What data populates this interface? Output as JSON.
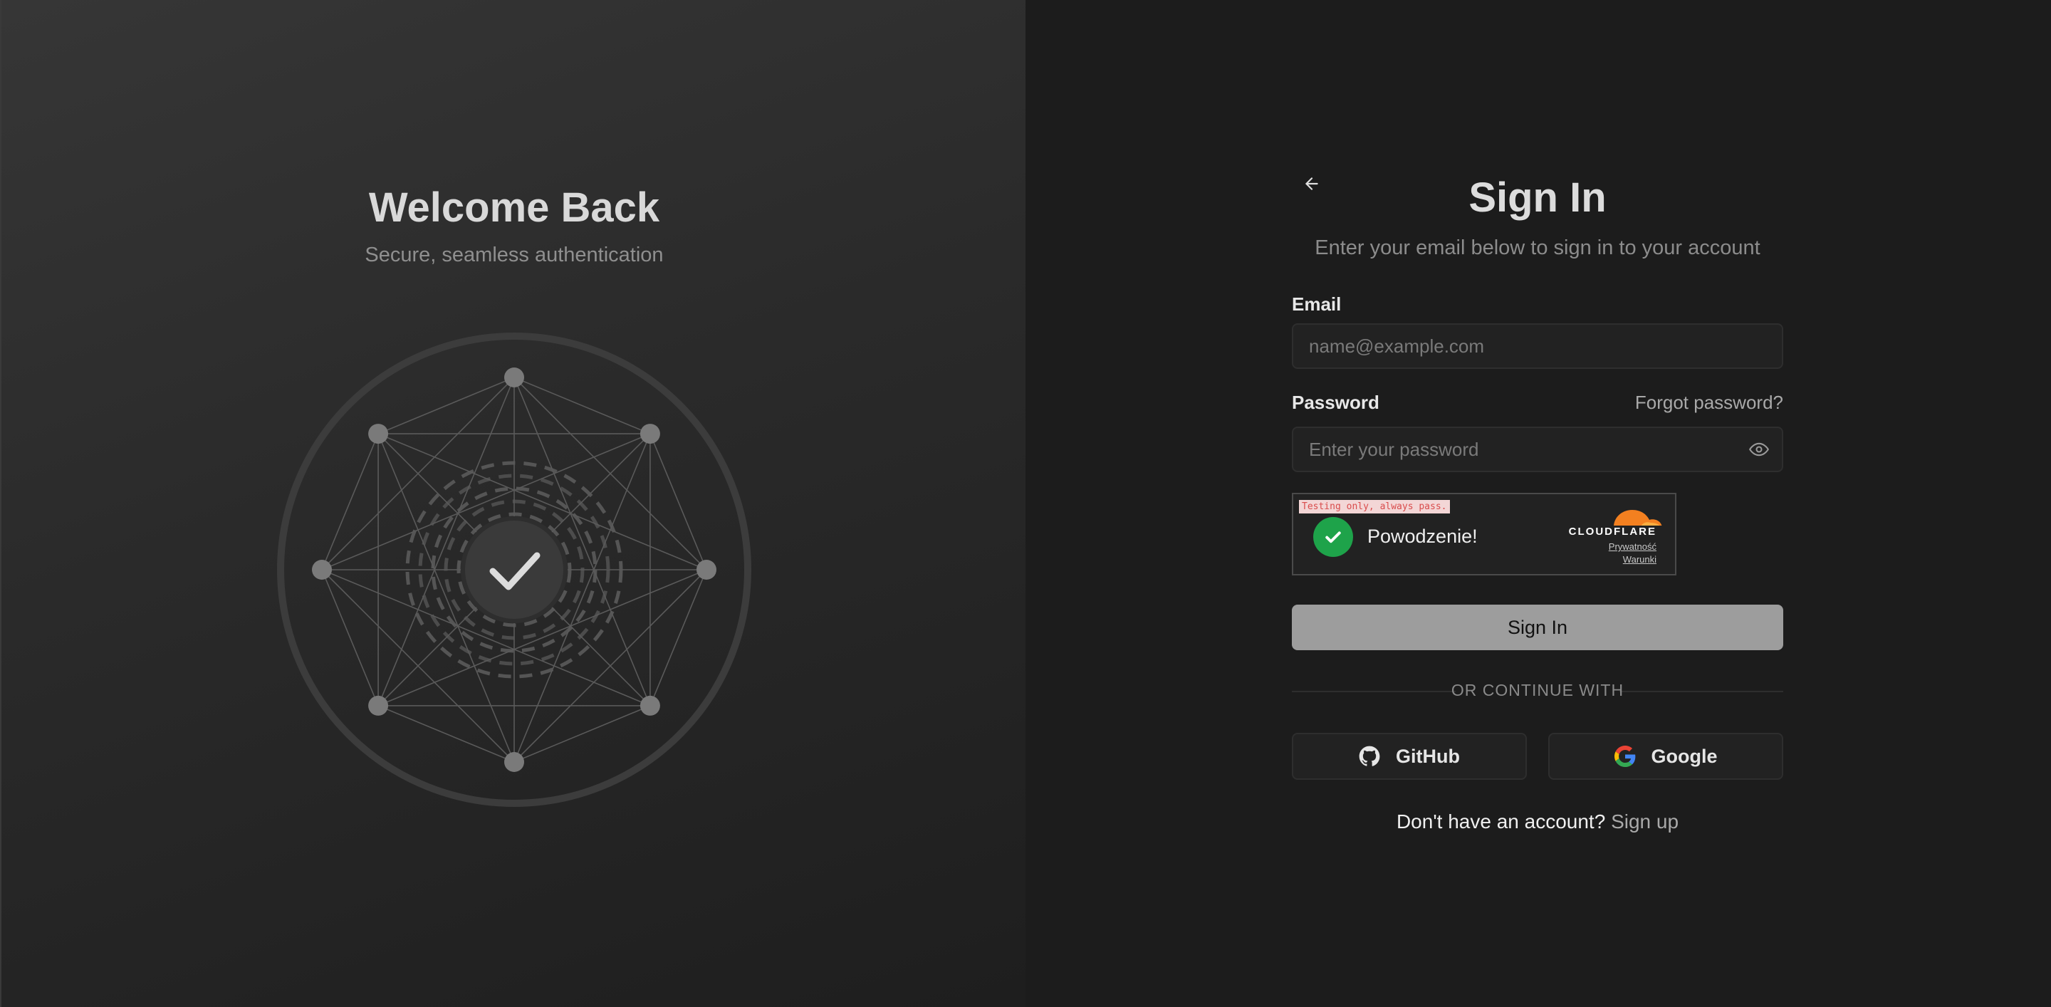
{
  "left": {
    "title": "Welcome Back",
    "subtitle": "Secure, seamless authentication"
  },
  "form": {
    "title": "Sign In",
    "subtitle": "Enter your email below to sign in to your account",
    "email_label": "Email",
    "email_placeholder": "name@example.com",
    "password_label": "Password",
    "forgot_label": "Forgot password?",
    "password_placeholder": "Enter your password",
    "submit_label": "Sign In",
    "divider_label": "OR CONTINUE WITH",
    "github_label": "GitHub",
    "google_label": "Google",
    "no_account_text": "Don't have an account?",
    "signup_label": "Sign up"
  },
  "captcha": {
    "test_banner": "Testing only, always pass.",
    "status": "Powodzenie!",
    "brand": "CLOUDFLARE",
    "privacy_link": "Prywatność",
    "terms_link": "Warunki"
  },
  "icons": {
    "back": "arrow-left-icon",
    "eye": "eye-icon",
    "success": "checkmark-icon",
    "github": "github-icon",
    "google": "google-icon",
    "network": "shield-network-icon"
  },
  "colors": {
    "accent_success": "#1ea34a",
    "cloudflare_orange": "#f38020",
    "submit_button": "#9d9d9d"
  }
}
